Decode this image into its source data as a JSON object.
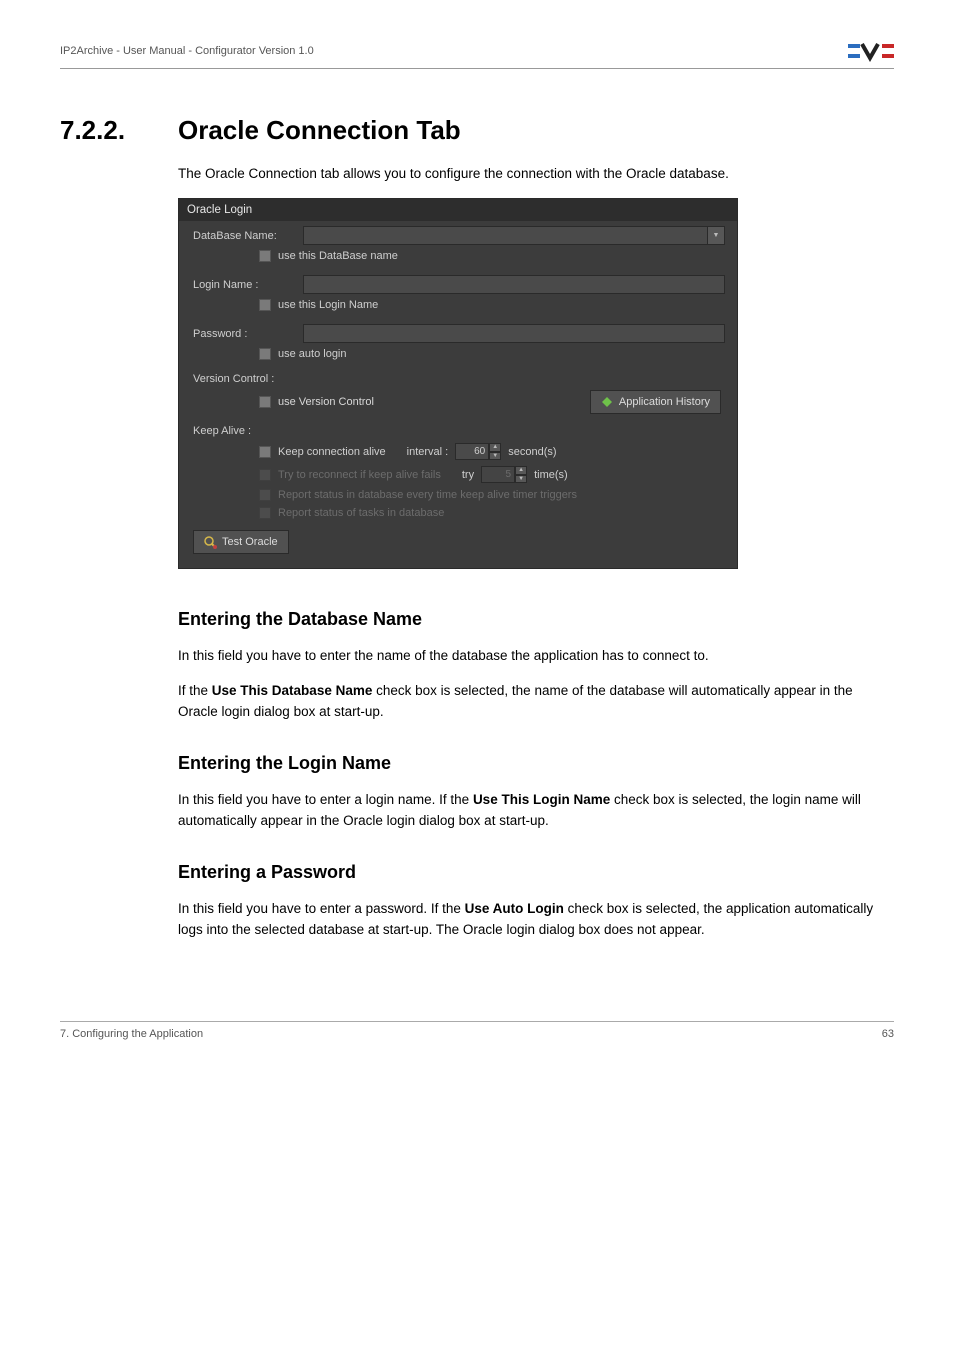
{
  "header": {
    "breadcrumb": "IP2Archive - User Manual - Configurator Version 1.0"
  },
  "section": {
    "number": "7.2.2.",
    "title": "Oracle Connection Tab",
    "intro": "The Oracle Connection tab allows you to configure the connection with the Oracle database."
  },
  "panel": {
    "title": "Oracle Login",
    "database": {
      "label": "DataBase Name:",
      "use_label": "use this DataBase name"
    },
    "login": {
      "label": "Login Name :",
      "use_label": "use this Login Name"
    },
    "password": {
      "label": "Password :",
      "use_label": "use auto login"
    },
    "version": {
      "label": "Version Control :",
      "use_label": "use Version Control",
      "history_btn": "Application History"
    },
    "keep": {
      "label": "Keep Alive :",
      "row1_a": "Keep connection alive",
      "row1_b": "interval :",
      "row1_val": "60",
      "row1_unit": "second(s)",
      "row2_a": "Try to reconnect if keep alive fails",
      "row2_b": "try",
      "row2_val": "5",
      "row2_unit": "time(s)",
      "row3": "Report status in database every time keep alive timer triggers",
      "row4": "Report status of tasks in database"
    },
    "test_btn": "Test Oracle"
  },
  "subs": {
    "db": {
      "heading": "Entering the Database Name",
      "p1": "In this field you have to enter the name of the database the application has to connect to.",
      "p2a": "If the ",
      "p2b": "Use This Database Name",
      "p2c": " check box is selected, the name of the database will automatically appear in the Oracle login dialog box at start-up."
    },
    "login": {
      "heading": "Entering the Login Name",
      "p1a": "In this field you have to enter a login name. If the ",
      "p1b": "Use This Login Name",
      "p1c": " check box is selected, the login name will automatically appear in the Oracle login dialog box at start-up."
    },
    "pw": {
      "heading": "Entering a Password",
      "p1a": "In this field you have to enter a password. If the ",
      "p1b": "Use Auto Login",
      "p1c": " check box is selected, the application automatically logs into the selected database at start-up. The Oracle login dialog box does not appear."
    }
  },
  "footer": {
    "left": "7. Configuring the Application",
    "right": "63"
  }
}
